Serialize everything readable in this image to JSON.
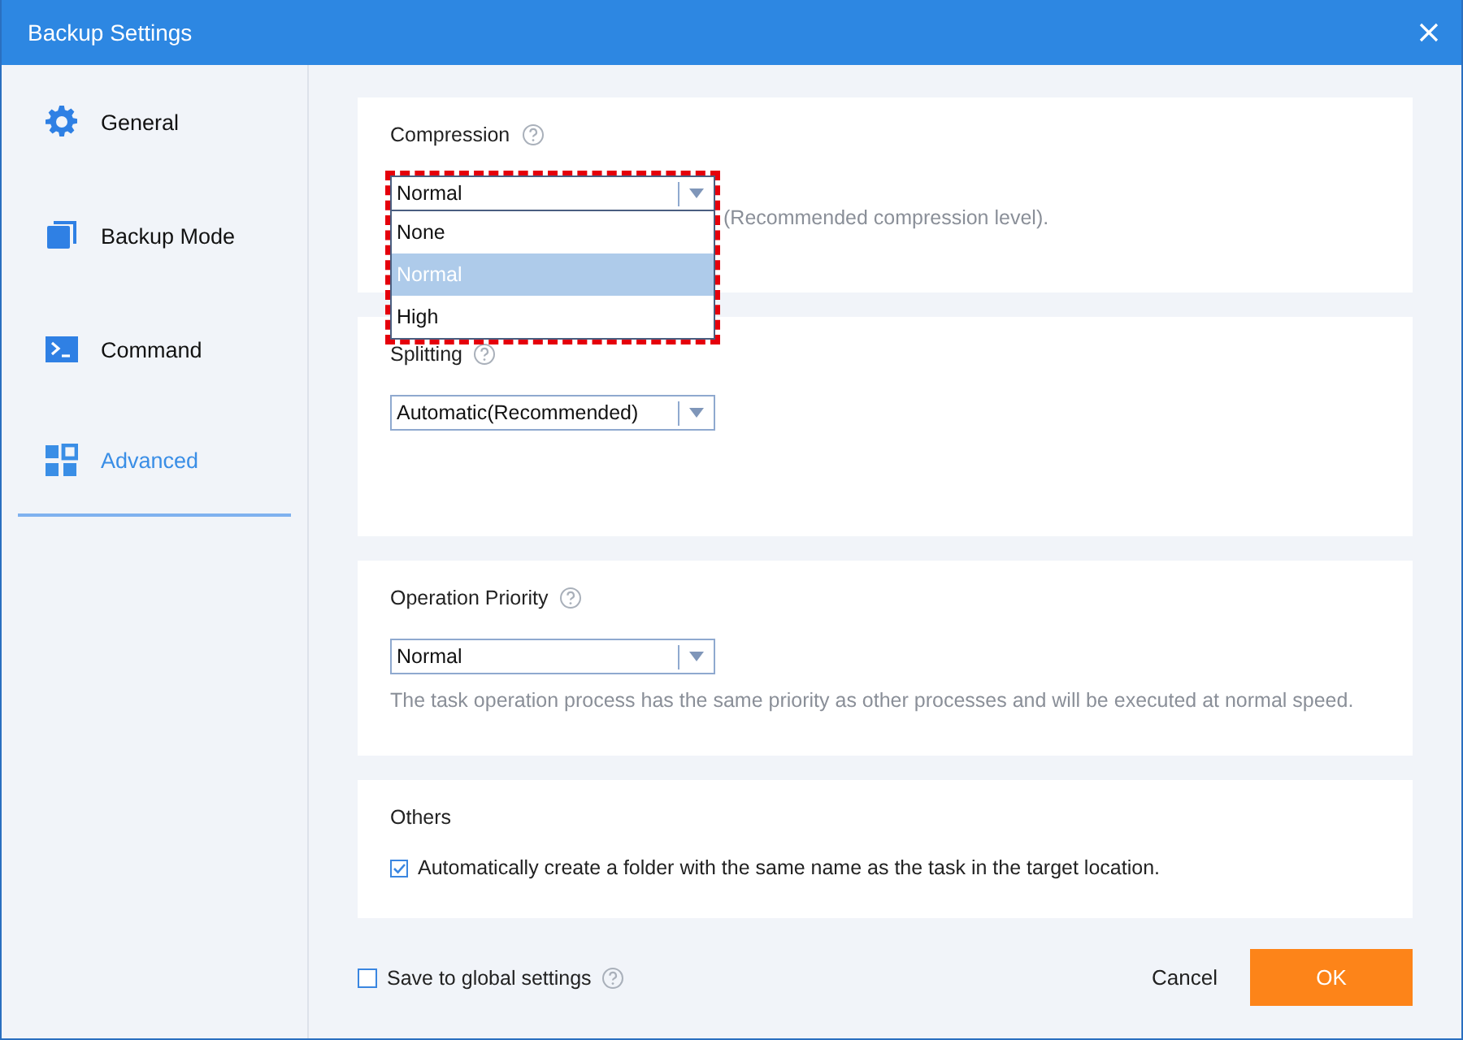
{
  "window": {
    "title": "Backup Settings"
  },
  "sidebar": {
    "items": [
      {
        "label": "General",
        "kind": "gear",
        "selected": false
      },
      {
        "label": "Backup Mode",
        "kind": "stack",
        "selected": false
      },
      {
        "label": "Command",
        "kind": "terminal",
        "selected": false
      },
      {
        "label": "Advanced",
        "kind": "tiles",
        "selected": true
      }
    ]
  },
  "sections": [
    {
      "title": "Compression",
      "select": {
        "value": "Normal",
        "open": true,
        "highlighted": true,
        "options": [
          {
            "label": "None",
            "selected": false
          },
          {
            "label": "Normal",
            "selected": true
          },
          {
            "label": "High",
            "selected": false
          }
        ]
      },
      "description": "(Recommended compression level)."
    },
    {
      "title": "Splitting",
      "select": {
        "value": "Automatic(Recommended)",
        "open": false
      }
    },
    {
      "title": "Operation Priority",
      "select": {
        "value": "Normal",
        "open": false
      },
      "description": "The task operation process has the same priority as other processes and will be executed at normal speed."
    },
    {
      "title": "Others",
      "checkbox": {
        "label": "Automatically create a folder with the same name as the task in the target location.",
        "checked": true
      }
    }
  ],
  "footer": {
    "save_global": {
      "label": "Save to global settings",
      "checked": false
    },
    "buttons": [
      {
        "label": "Cancel",
        "kind": "plain"
      },
      {
        "label": "OK",
        "kind": "primary"
      }
    ]
  }
}
